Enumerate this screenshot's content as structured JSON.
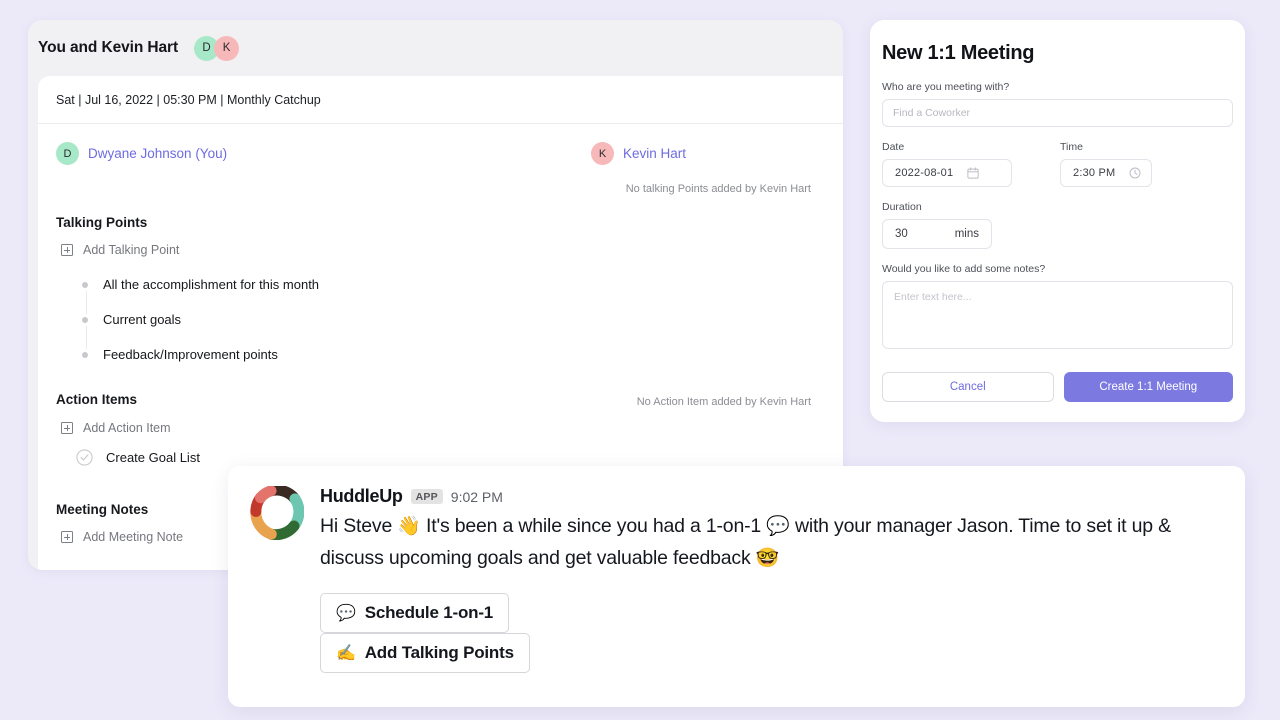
{
  "meeting_card": {
    "title": "You and Kevin Hart",
    "avatars": [
      {
        "initial": "D",
        "color": "#a7e8c8"
      },
      {
        "initial": "K",
        "color": "#f6b8b8"
      }
    ],
    "datebar": "Sat | Jul 16, 2022 | 05:30 PM | Monthly Catchup",
    "participant_left": {
      "initial": "D",
      "name": "Dwyane Johnson (You)"
    },
    "participant_right": {
      "initial": "K",
      "name": "Kevin Hart"
    },
    "talking_points": {
      "heading": "Talking Points",
      "add_label": "Add Talking Point",
      "items": [
        "All the accomplishment for this month",
        "Current goals",
        "Feedback/Improvement points"
      ],
      "empty_right": "No talking Points added by Kevin Hart"
    },
    "action_items": {
      "heading": "Action Items",
      "add_label": "Add Action Item",
      "items": [
        "Create Goal List"
      ],
      "empty_right": "No Action Item added by Kevin Hart"
    },
    "meeting_notes": {
      "heading": "Meeting Notes",
      "add_label": "Add Meeting Note"
    }
  },
  "new_meeting_panel": {
    "title": "New 1:1 Meeting",
    "coworker": {
      "label": "Who are you meeting with?",
      "placeholder": "Find a Coworker",
      "value": ""
    },
    "date": {
      "label": "Date",
      "value": "2022-08-01",
      "icon": "calendar-icon"
    },
    "time": {
      "label": "Time",
      "value": "2:30 PM",
      "icon": "clock-icon"
    },
    "duration": {
      "label": "Duration",
      "value": "30",
      "unit": "mins"
    },
    "notes": {
      "label": "Would you like to add some notes?",
      "placeholder": "Enter text here...",
      "value": ""
    },
    "cancel_label": "Cancel",
    "create_label": "Create 1:1 Meeting",
    "accent_color": "#7c7ae0"
  },
  "huddle_message": {
    "sender": "HuddleUp",
    "app_badge": "APP",
    "timestamp": "9:02 PM",
    "text_part_1": "Hi Steve ",
    "emoji_wave": "👋",
    "text_part_2": " It's been a while since you had a 1-on-1 ",
    "emoji_speech": "💬",
    "text_part_3": " with your manager Jason. Time to set it up & discuss upcoming goals and get valuable feedback ",
    "emoji_nerd": "🤓",
    "buttons": [
      {
        "emoji": "💬",
        "label": "Schedule 1-on-1"
      },
      {
        "emoji": "✍️",
        "label": "Add Talking Points"
      }
    ]
  }
}
